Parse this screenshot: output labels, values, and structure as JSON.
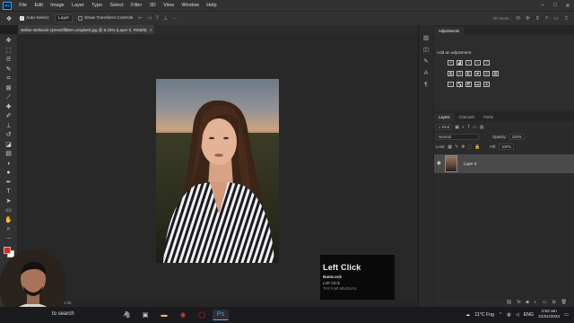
{
  "menubar": {
    "logo": "Ps",
    "items": [
      "File",
      "Edit",
      "Image",
      "Layer",
      "Type",
      "Select",
      "Filter",
      "3D",
      "View",
      "Window",
      "Help"
    ],
    "window_controls": [
      "–",
      "□",
      "✕"
    ]
  },
  "options": {
    "auto_select_label": "Auto-Select:",
    "auto_select_value": "Layer",
    "show_transform_label": "Show Transform Controls",
    "mode_3d_label": "3D Mode:"
  },
  "document": {
    "tab_title": "stefan-stefancik-QXevDflbl8A-unsplash.jpg @ 8.33% (Layer 0, RGB/8)",
    "tab_close": "×",
    "status": "3042/102.3K"
  },
  "key_overlay": {
    "action": "Left Click",
    "state": "NumLock",
    "detail": "Left Click",
    "credit": "TAYYAB MUGHAL"
  },
  "adjustments": {
    "tab_label": "Adjustments",
    "add_label": "Add an adjustment"
  },
  "layers": {
    "tabs": [
      "Layers",
      "Channels",
      "Paths"
    ],
    "kind_label": "Kind",
    "blend_mode": "Normal",
    "opacity_label": "Opacity:",
    "opacity_value": "100%",
    "lock_label": "Lock:",
    "fill_label": "Fill:",
    "fill_value": "100%",
    "layer_name": "Layer 0"
  },
  "taskbar": {
    "search_label": "to search",
    "weather": "11°C Fog",
    "language": "ENG",
    "time": "4:52 am",
    "date": "31/01/2023"
  }
}
